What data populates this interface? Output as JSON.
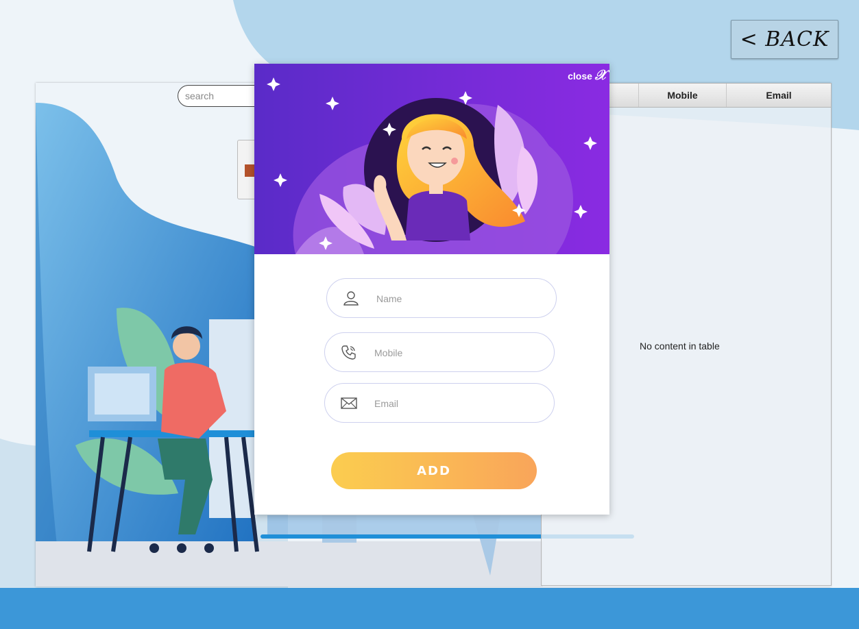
{
  "header": {
    "back_label": "< BACK"
  },
  "search": {
    "placeholder": "search"
  },
  "table": {
    "columns": [
      "",
      "Mobile",
      "Email"
    ],
    "empty_message": "No content in table"
  },
  "dialog": {
    "close_label": "close",
    "close_glyph": "𝒳",
    "fields": {
      "name": {
        "placeholder": "Name",
        "value": "",
        "icon": "user-icon"
      },
      "mobile": {
        "placeholder": "Mobile",
        "value": "",
        "icon": "phone-icon"
      },
      "email": {
        "placeholder": "Email",
        "value": "",
        "icon": "envelope-icon"
      }
    },
    "add_label": "ADD"
  },
  "colors": {
    "dialog_header_purple": "#7b2fd8",
    "add_gradient_start": "#fbcd4f",
    "add_gradient_end": "#f9a55a",
    "field_border": "#cdd0ee",
    "background_blue": "#2f8fd6"
  }
}
